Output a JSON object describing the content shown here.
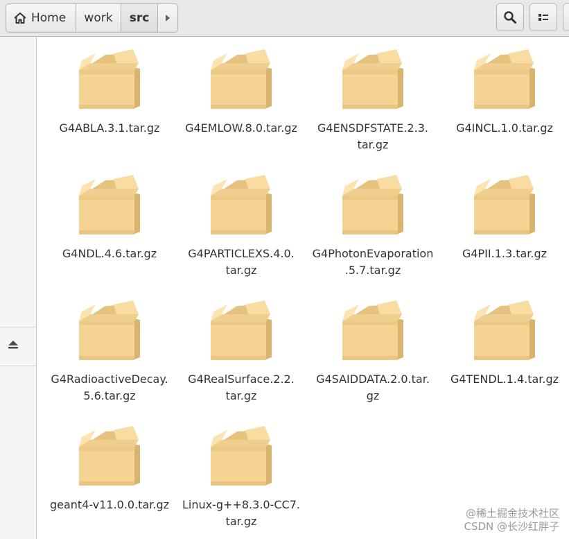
{
  "pathbar": {
    "crumbs": [
      "Home",
      "work",
      "src"
    ]
  },
  "icons": {
    "home": "home-icon",
    "forward": "chevron-right-icon",
    "search": "search-icon",
    "view": "list-view-icon",
    "eject": "eject-icon",
    "file": "package-archive-icon"
  },
  "colors": {
    "box_front": "#f5d493",
    "box_side": "#e9c27c",
    "box_top": "#fbe4b2",
    "header_bg": "#e8e8e7"
  },
  "files": [
    {
      "line1": "G4ABLA.3.1.tar.gz",
      "line2": ""
    },
    {
      "line1": "G4EMLOW.8.0.tar.gz",
      "line2": ""
    },
    {
      "line1": "G4ENSDFSTATE.2.3.",
      "line2": "tar.gz"
    },
    {
      "line1": "G4INCL.1.0.tar.gz",
      "line2": ""
    },
    {
      "line1": "G4NDL.4.6.tar.gz",
      "line2": ""
    },
    {
      "line1": "G4PARTICLEXS.4.0.",
      "line2": "tar.gz"
    },
    {
      "line1": "G4PhotonEvaporation",
      "line2": ".5.7.tar.gz"
    },
    {
      "line1": "G4PII.1.3.tar.gz",
      "line2": ""
    },
    {
      "line1": "G4RadioactiveDecay.",
      "line2": "5.6.tar.gz"
    },
    {
      "line1": "G4RealSurface.2.2.",
      "line2": "tar.gz"
    },
    {
      "line1": "G4SAIDDATA.2.0.tar.",
      "line2": "gz"
    },
    {
      "line1": "G4TENDL.1.4.tar.gz",
      "line2": ""
    },
    {
      "line1": "geant4-v11.0.0.tar.gz",
      "line2": ""
    },
    {
      "line1": "Linux-g++8.3.0-CC7.",
      "line2": "tar.gz"
    }
  ],
  "watermark": {
    "line1": "@稀土掘金技术社区",
    "line2": "CSDN @长沙红胖子"
  }
}
